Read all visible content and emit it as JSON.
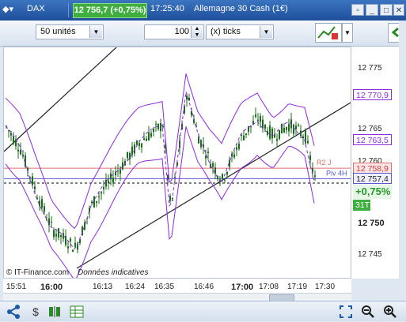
{
  "title_bar": {
    "ticker": "DAX",
    "price_badge": "12 756,7 (+0,75%)",
    "time": "17:25:40",
    "instrument": "Allemagne 30 Cash (1€)"
  },
  "toolbar": {
    "units_select": "50 unités",
    "quantity": "100",
    "period_select": "(x) ticks"
  },
  "price_axis": {
    "labels": [
      "12 775",
      "12 770,9",
      "12 765",
      "12 763,5",
      "12 760",
      "12 758,9",
      "12 757,4",
      "+0,75%",
      "31T",
      "12 750",
      "12 745"
    ],
    "bold_label": "12 750"
  },
  "chart_annotations": {
    "r2": "R2 J",
    "pivot": "Piv 4H",
    "copyright": "© IT-Finance.com",
    "disclaimer": "Données indicatives"
  },
  "time_axis": {
    "labels": [
      "15:51",
      "16:00",
      "16:13",
      "16:24",
      "16:35",
      "16:46",
      "17:00",
      "17:08",
      "17:19",
      "17:30"
    ]
  },
  "colors": {
    "up_badge": "#3fae3f",
    "bollinger": "#8a2be2",
    "candle": "#1a6b1a",
    "r2_line": "#e07070",
    "pivot_line": "#5a5ad0"
  }
}
